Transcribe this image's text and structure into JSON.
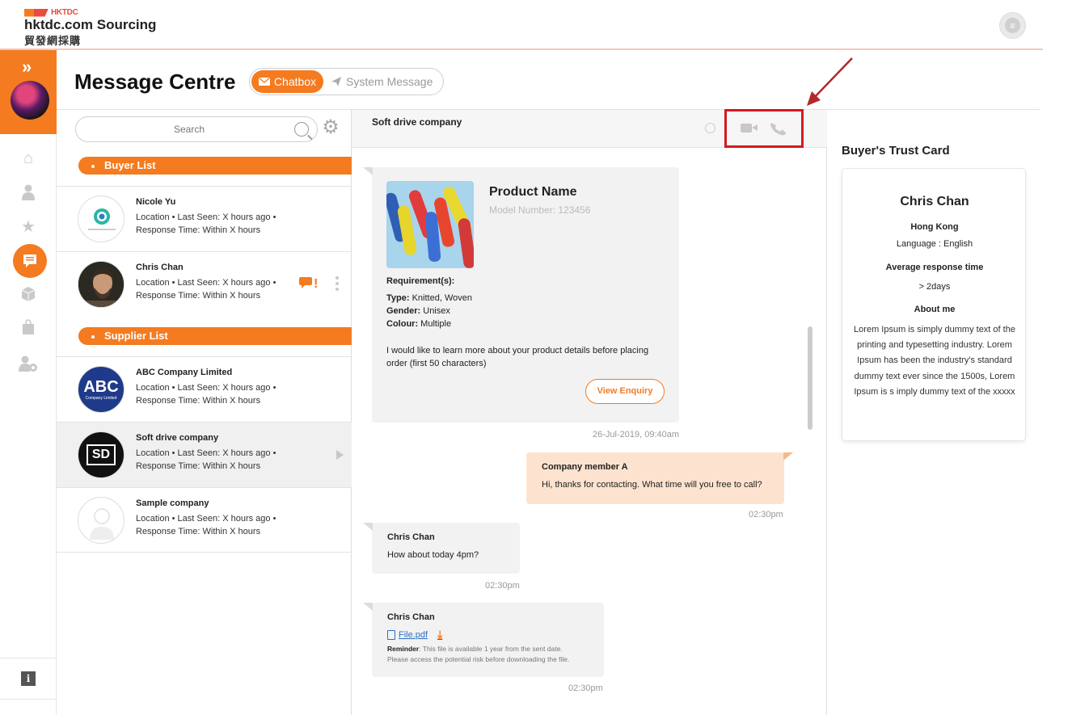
{
  "header": {
    "brand_small": "HKTDC",
    "brand_title": "hktdc.com Sourcing",
    "brand_chinese": "貿發網採購"
  },
  "page": {
    "title": "Message Centre",
    "tabs": [
      {
        "label": "Chatbox",
        "active": true
      },
      {
        "label": "System Message",
        "active": false
      }
    ]
  },
  "list": {
    "search_placeholder": "Search",
    "buyer_section": "Buyer List",
    "supplier_section": "Supplier List",
    "buyers": [
      {
        "name": "Nicole Yu",
        "line1": "Location  •  Last Seen: X hours ago  •",
        "line2": "Response Time: Within X hours"
      },
      {
        "name": "Chris Chan",
        "line1": "Location  •  Last Seen: X hours ago  •",
        "line2": "Response Time: Within X hours",
        "badge": "!"
      }
    ],
    "suppliers": [
      {
        "name": "ABC Company Limited",
        "line1": "Location  •  Last Seen: X hours ago  •",
        "line2": "Response Time: Within X hours",
        "logo_text": "ABC",
        "logo_sub": "Company Limited"
      },
      {
        "name": "Soft drive company",
        "line1": "Location  •  Last Seen: X hours ago  •",
        "line2": "Response Time: Within X hours",
        "logo_text": "SD",
        "selected": true
      },
      {
        "name": "Sample company",
        "line1": "Location  •  Last Seen: X hours ago  •",
        "line2": "Response Time: Within X hours"
      }
    ]
  },
  "chat": {
    "title": "Soft drive company",
    "enquiry": {
      "product_name": "Product Name",
      "model": "Model Number: 123456",
      "req_title": "Requirement(s):",
      "type_label": "Type:",
      "type_value": "Knitted, Woven",
      "gender_label": "Gender:",
      "gender_value": "Unisex",
      "colour_label": "Colour:",
      "colour_value": "Multiple",
      "message_l1": "I would like to learn more about your product details before placing",
      "message_l2": "order (first 50 characters)",
      "button": "View Enquiry",
      "time": "26-Jul-2019, 09:40am"
    },
    "reply": {
      "sender": "Company member A",
      "text": "Hi, thanks for contacting. What time will you free to call?",
      "time": "02:30pm"
    },
    "msg2": {
      "sender": "Chris Chan",
      "text": "How about today 4pm?",
      "time": "02:30pm"
    },
    "msg3": {
      "sender": "Chris Chan",
      "file": "File.pdf",
      "reminder_label": "Reminder",
      "reminder_l1": ": This file is available 1 year from the sent date.",
      "reminder_l2": "Please access the potential risk before downloading the file.",
      "time": "02:30pm"
    }
  },
  "trust_card": {
    "title": "Buyer's Trust Card",
    "name": "Chris Chan",
    "location": "Hong Kong",
    "language": "Language : English",
    "avg_label": "Average response time",
    "avg_value": "> 2days",
    "about_label": "About me",
    "about": "Lorem Ipsum is simply dummy text of the printing and typesetting industry. Lorem Ipsum has been the industry's standard dummy text ever since the 1500s, Lorem Ipsum is s imply dummy text of the xxxxx"
  },
  "colors": {
    "accent": "#f47b20",
    "highlight_box": "#d4191e",
    "link": "#2c6fc3"
  }
}
